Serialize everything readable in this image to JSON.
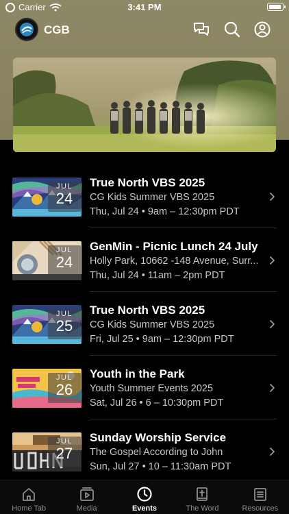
{
  "status_bar": {
    "carrier": "Carrier",
    "time": "3:41 PM"
  },
  "header": {
    "app_name": "CGB"
  },
  "events": [
    {
      "month": "JUL",
      "day": "24",
      "title": "True North VBS 2025",
      "subtitle": "CG Kids Summer VBS 2025",
      "time": "Thu, Jul 24 • 9am – 12:30pm PDT",
      "thumb": "vbs"
    },
    {
      "month": "JUL",
      "day": "24",
      "title": "GenMin  - Picnic Lunch 24 July",
      "subtitle": "Holly Park, 10662 -148 Avenue, Surr...",
      "time": "Thu, Jul 24 • 11am – 2pm PDT",
      "thumb": "picnic"
    },
    {
      "month": "JUL",
      "day": "25",
      "title": "True North VBS 2025",
      "subtitle": "CG Kids Summer VBS 2025",
      "time": "Fri, Jul 25 • 9am – 12:30pm PDT",
      "thumb": "vbs"
    },
    {
      "month": "JUL",
      "day": "26",
      "title": "Youth in the Park",
      "subtitle": "Youth Summer Events 2025",
      "time": "Sat, Jul 26 • 6 – 10:30pm PDT",
      "thumb": "youth"
    },
    {
      "month": "JUL",
      "day": "27",
      "title": "Sunday Worship Service",
      "subtitle": "The Gospel According to John",
      "time": "Sun, Jul 27 • 10 – 11:30am PDT",
      "thumb": "john"
    }
  ],
  "tabs": [
    {
      "label": "Home Tab",
      "icon": "home-icon",
      "active": false
    },
    {
      "label": "Media",
      "icon": "media-icon",
      "active": false
    },
    {
      "label": "Events",
      "icon": "clock-icon",
      "active": true
    },
    {
      "label": "The Word",
      "icon": "bible-icon",
      "active": false
    },
    {
      "label": "Resources",
      "icon": "resources-icon",
      "active": false
    }
  ],
  "colors": {
    "header_bg": "#8a8460",
    "background": "#000000",
    "secondary_text": "#c8c8c8",
    "inactive_tab": "#8e8e8e"
  }
}
